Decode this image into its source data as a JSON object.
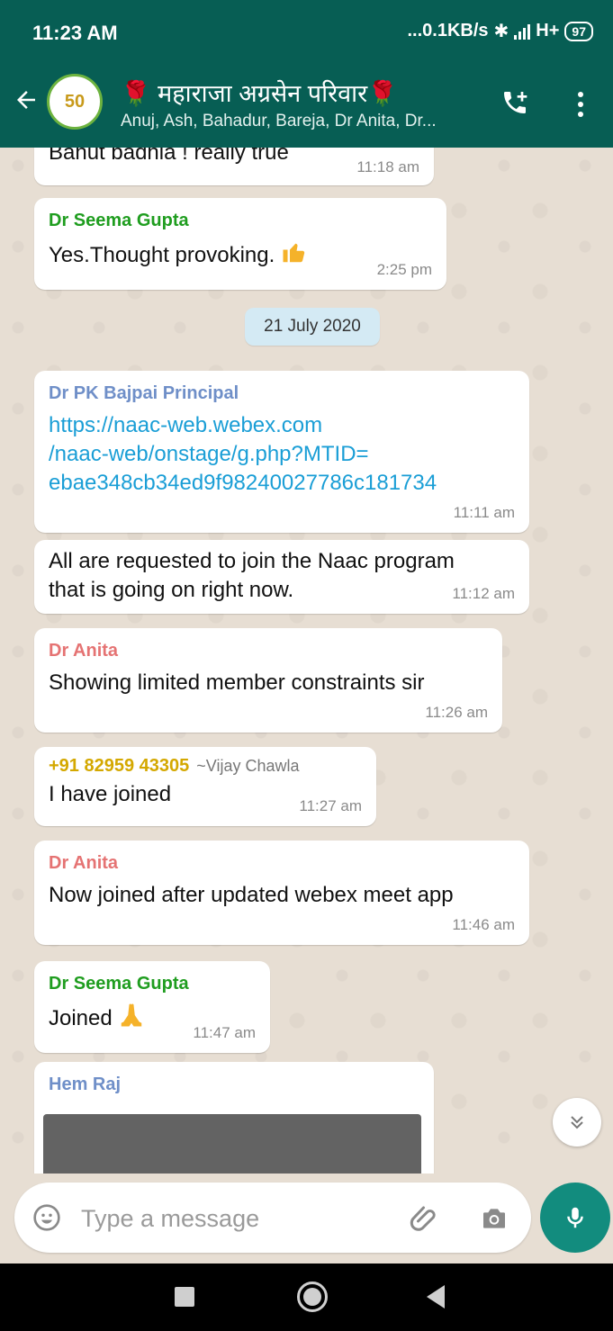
{
  "status": {
    "time": "11:23 AM",
    "speed": "...0.1KB/s",
    "network": "H+",
    "battery": "97"
  },
  "header": {
    "title": "🌹 महाराजा अग्रसेन परिवार🌹",
    "subtitle": "Anuj, Ash, Bahadur, Bareja, Dr Anita, Dr...",
    "avatar_text": "50"
  },
  "colors": {
    "header": "#075e54",
    "accent": "#128c7e",
    "sender_green": "#1f9d1f",
    "sender_blue": "#6f8fc8",
    "sender_red": "#e57373",
    "sender_gold": "#d4a800",
    "link": "#1a9ed6"
  },
  "messages": {
    "m1": {
      "text": "Bahut badhia ! really true",
      "time": "11:18 am"
    },
    "m2": {
      "sender": "Dr Seema Gupta",
      "text": "Yes.Thought provoking.",
      "emoji": "thumbs-up",
      "time": "2:25 pm"
    },
    "date": "21 July 2020",
    "m3": {
      "sender": "Dr PK Bajpai Principal",
      "link_l1": "https://naac-web.webex.com",
      "link_l2": "/naac-web/onstage/g.php?MTID=",
      "link_l3": "ebae348cb34ed9f98240027786c181734",
      "time": "11:11 am"
    },
    "m4": {
      "line1": "All are requested to join the Naac program",
      "line2": "that is going on right now.",
      "time": "11:12 am"
    },
    "m5": {
      "sender": "Dr Anita",
      "text": "Showing limited member constraints sir",
      "time": "11:26 am"
    },
    "m6": {
      "sender": "+91 82959 43305",
      "altname": "~Vijay Chawla",
      "text": "I have joined",
      "time": "11:27 am"
    },
    "m7": {
      "sender": "Dr Anita",
      "text": "Now joined after updated webex meet app",
      "time": "11:46 am"
    },
    "m8": {
      "sender": "Dr Seema Gupta",
      "text": "Joined",
      "emoji": "folded-hands",
      "time": "11:47 am"
    },
    "m9": {
      "sender": "Hem Raj"
    }
  },
  "input": {
    "placeholder": "Type a message"
  }
}
